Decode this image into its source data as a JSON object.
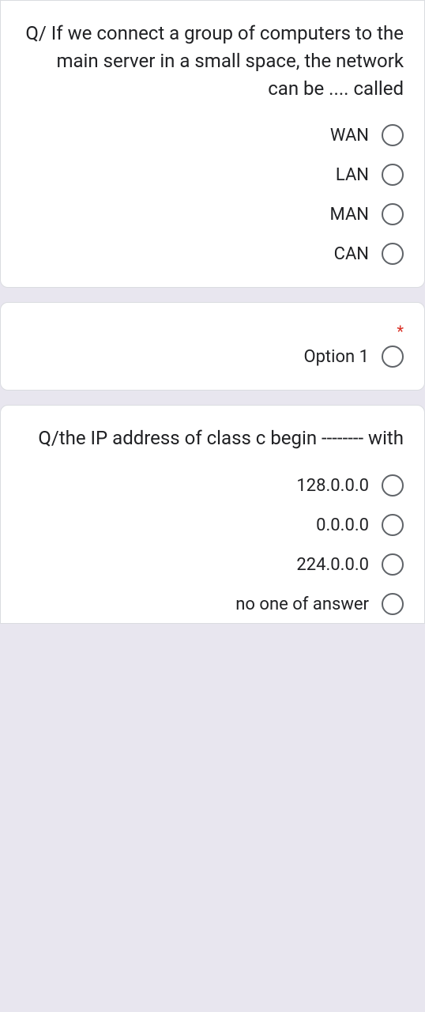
{
  "q1": {
    "text": "Q/ If we connect a group of computers to the main server in a small space, the network can be .... called",
    "options": [
      "WAN",
      "LAN",
      "MAN",
      "CAN"
    ]
  },
  "q2": {
    "required_mark": "*",
    "options": [
      "Option 1"
    ]
  },
  "q3": {
    "text": "Q/the IP  address of class c  begin -------- with",
    "options": [
      "128.0.0.0",
      "0.0.0.0",
      "224.0.0.0",
      "no one of answer"
    ]
  }
}
